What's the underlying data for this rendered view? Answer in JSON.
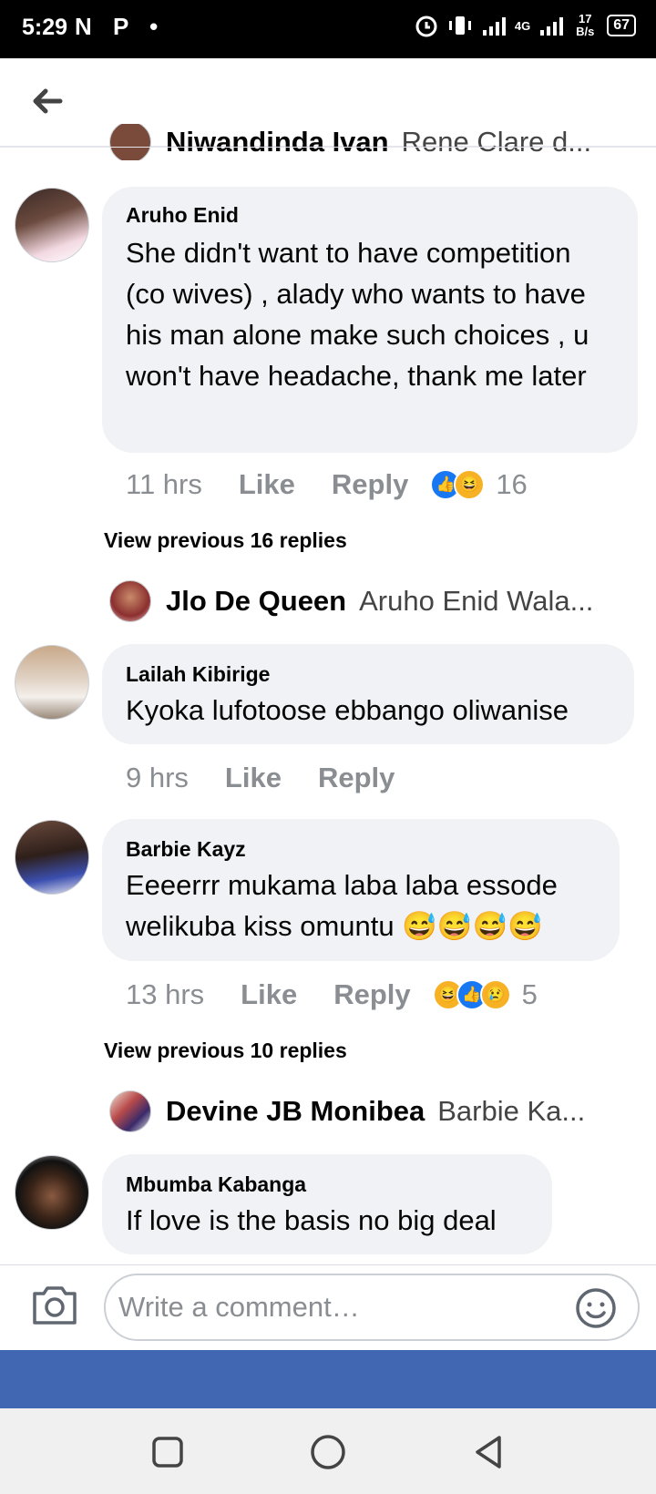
{
  "status_bar": {
    "time": "5:29",
    "left_icons": "N P •",
    "net_speed": "17 B/s",
    "network": "4G",
    "battery": "67"
  },
  "header": {
    "back_icon": "arrow-left-icon"
  },
  "partial_reply": {
    "name": "Niwandinda Ivan",
    "text": "Rene Clare d..."
  },
  "comments": [
    {
      "author": "Aruho Enid",
      "text": "She didn't want to have competition (co wives) , alady who wants to have his man alone make such choices , u won't have headache, thank me later",
      "time": "11 hrs",
      "like": "Like",
      "reply": "Reply",
      "reactions_count": "16"
    },
    {
      "author": "Lailah Kibirige",
      "text": "Kyoka lufotoose ebbango oliwanise",
      "time": "9 hrs",
      "like": "Like",
      "reply": "Reply"
    },
    {
      "author": "Barbie Kayz",
      "text": "Eeeerrr mukama laba laba essode welikuba kiss omuntu 😅😅😅😅",
      "time": "13 hrs",
      "like": "Like",
      "reply": "Reply",
      "reactions_count": "5"
    },
    {
      "author": "Mbumba Kabanga",
      "text": "If love is the basis no big deal"
    }
  ],
  "view_previous": [
    "View previous 16 replies",
    "View previous 10 replies"
  ],
  "replies": [
    {
      "name": "Jlo De Queen",
      "text": "Aruho Enid Wala..."
    },
    {
      "name": "Devine JB Monibea",
      "text": "Barbie Ka..."
    }
  ],
  "composer": {
    "placeholder": "Write a comment…"
  },
  "colors": {
    "facebook_blue": "#4267b2",
    "like_blue": "#1877f2",
    "bubble_gray": "#f0f2f5"
  }
}
